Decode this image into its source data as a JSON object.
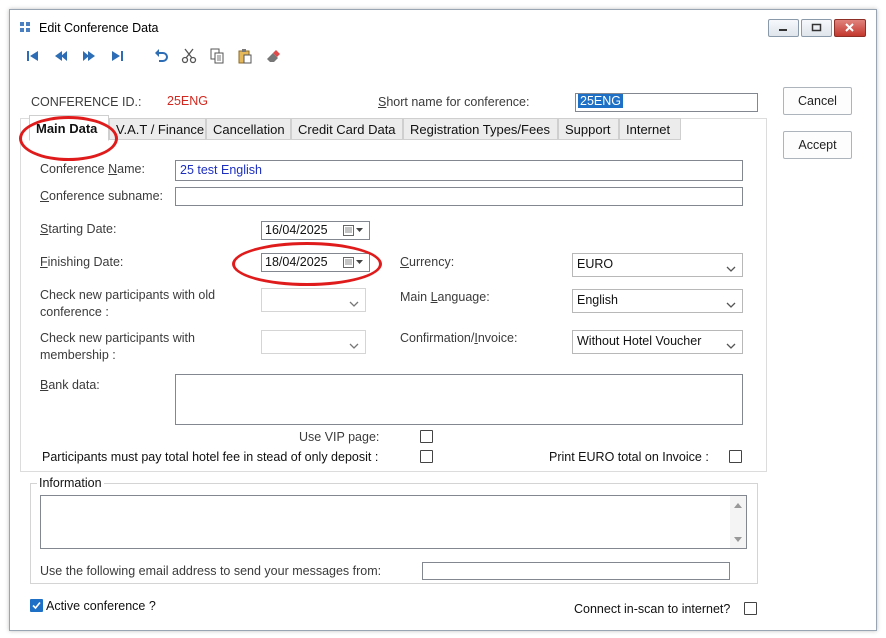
{
  "window": {
    "title": "Edit Conference Data"
  },
  "header": {
    "conference_id_label": "CONFERENCE ID.:",
    "conference_id_value": "25ENG",
    "short_name_label": "Short name for conference:",
    "short_name_value": "25ENG"
  },
  "buttons": {
    "cancel": "Cancel",
    "accept": "Accept"
  },
  "tabs": [
    {
      "label": "Main Data"
    },
    {
      "label": "V.A.T / Finance"
    },
    {
      "label": "Cancellation"
    },
    {
      "label": "Credit Card Data"
    },
    {
      "label": "Registration Types/Fees"
    },
    {
      "label": "Support"
    },
    {
      "label": "Internet"
    }
  ],
  "main": {
    "conference_name_label": "Conference Name:",
    "conference_name_value": "25 test English",
    "subname_label": "Conference subname:",
    "subname_value": "",
    "starting_date_label": "Starting Date:",
    "starting_date_value": "16/04/2025",
    "finishing_date_label": "Finishing Date:",
    "finishing_date_value": "18/04/2025",
    "currency_label": "Currency:",
    "currency_value": "EURO",
    "old_conf_label_1": "Check new participants with old",
    "old_conf_label_2": "conference :",
    "main_language_label": "Main Language:",
    "main_language_value": "English",
    "membership_label_1": "Check new participants with",
    "membership_label_2": "membership :",
    "confirmation_label": "Confirmation/Invoice:",
    "confirmation_value": "Without Hotel Voucher",
    "bank_data_label": "Bank data:",
    "vip_label": "Use VIP page:",
    "total_fee_label": "Participants must pay total hotel fee in stead of only deposit :",
    "print_euro_label": "Print EURO total on Invoice :"
  },
  "information": {
    "legend": "Information",
    "email_label": "Use the following email address to send your messages from:",
    "email_value": ""
  },
  "footer": {
    "active_label": "Active conference ?",
    "active_checked": true,
    "connect_label": "Connect in-scan to internet?",
    "connect_checked": false
  },
  "colors": {
    "annotation": "#e01b1b",
    "id_value": "#d2281f",
    "link_text": "#1d2fc0",
    "selection": "#1e6fc6"
  },
  "icons": [
    "first-record-icon",
    "prev-record-icon",
    "next-record-icon",
    "last-record-icon",
    "undo-icon",
    "cut-icon",
    "copy-icon",
    "paste-icon",
    "eraser-icon"
  ]
}
